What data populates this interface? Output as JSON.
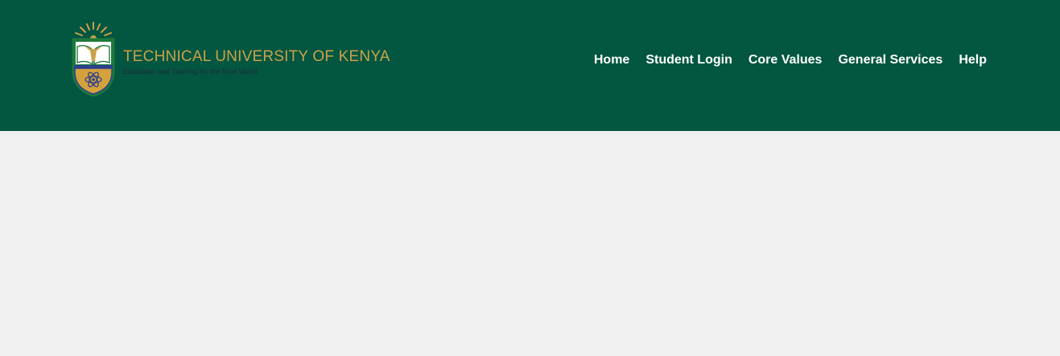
{
  "header": {
    "brand": {
      "name": "TECHNICAL UNIVERSITY OF KENYA",
      "tagline": "Education and Training for the Real World",
      "logo_icon": "university-crest-icon"
    },
    "nav": [
      {
        "label": "Home"
      },
      {
        "label": "Student Login"
      },
      {
        "label": "Core Values"
      },
      {
        "label": "General Services"
      },
      {
        "label": "Help"
      }
    ]
  },
  "colors": {
    "header_bg": "#035640",
    "brand_gold": "#c9a24a",
    "nav_text": "#ffffff",
    "page_bg": "#f0f0f0"
  }
}
